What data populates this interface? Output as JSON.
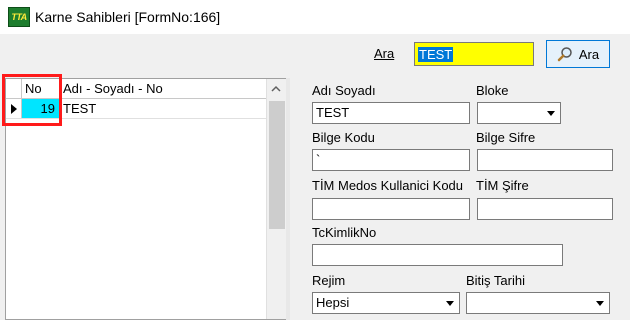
{
  "window": {
    "title": "Karne Sahibleri [FormNo:166]",
    "icon": "app-logo-icon",
    "icon_text": "TTA"
  },
  "search": {
    "label": "Ara",
    "value": "TEST",
    "button_label": "Ara"
  },
  "grid": {
    "columns": {
      "no": "No",
      "name": "Adı - Soyadı - No"
    },
    "rows": [
      {
        "no": "19",
        "name": "TEST"
      }
    ]
  },
  "form": {
    "ad_soyad": {
      "label": "Adı Soyadı",
      "value": "TEST"
    },
    "bloke": {
      "label": "Bloke",
      "value": ""
    },
    "bilge_kodu": {
      "label": "Bilge Kodu",
      "value": "`"
    },
    "bilge_sifre": {
      "label": "Bilge Sifre",
      "value": ""
    },
    "tim_medos_kullanici": {
      "label": "TİM Medos Kullanici Kodu",
      "value": ""
    },
    "tim_sifre": {
      "label": "TİM Şifre",
      "value": ""
    },
    "tc_kimlik": {
      "label": "TcKimlikNo",
      "value": ""
    },
    "rejim": {
      "label": "Rejim",
      "value": "Hepsi"
    },
    "bitis_tarihi": {
      "label": "Bitiş Tarihi",
      "value": ""
    }
  },
  "colors": {
    "search_bg": "#ffff00",
    "selected_cell": "#00e5ff",
    "highlight": "#ff1a1a",
    "button_border": "#0078d7"
  }
}
